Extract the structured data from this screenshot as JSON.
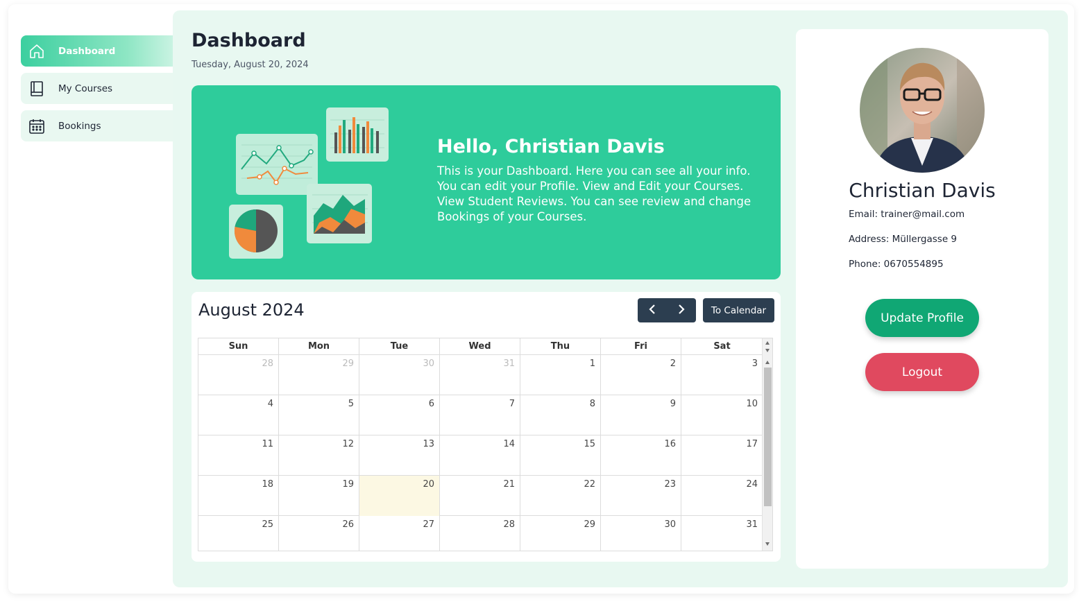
{
  "sidebar": {
    "items": [
      {
        "label": "Dashboard",
        "icon": "home-icon",
        "active": true
      },
      {
        "label": "My Courses",
        "icon": "book-icon",
        "active": false
      },
      {
        "label": "Bookings",
        "icon": "calendar-icon",
        "active": false
      }
    ]
  },
  "header": {
    "title": "Dashboard",
    "date": "Tuesday, August 20, 2024"
  },
  "hero": {
    "title": "Hello, Christian Davis",
    "text": "This is your Dashboard. Here you can see all your info. You can edit your Profile. View and Edit your Courses. View Student Reviews. You can see review and change Bookings of your Courses.",
    "illustration_icon": "analytics-charts-illustration"
  },
  "calendar": {
    "title": "August 2024",
    "prev_icon": "chevron-left-icon",
    "next_icon": "chevron-right-icon",
    "to_calendar_label": "To Calendar",
    "weekdays": [
      "Sun",
      "Mon",
      "Tue",
      "Wed",
      "Thu",
      "Fri",
      "Sat"
    ],
    "weeks": [
      [
        {
          "d": "28",
          "other": true
        },
        {
          "d": "29",
          "other": true
        },
        {
          "d": "30",
          "other": true
        },
        {
          "d": "31",
          "other": true
        },
        {
          "d": "1"
        },
        {
          "d": "2"
        },
        {
          "d": "3"
        }
      ],
      [
        {
          "d": "4"
        },
        {
          "d": "5"
        },
        {
          "d": "6"
        },
        {
          "d": "7"
        },
        {
          "d": "8"
        },
        {
          "d": "9"
        },
        {
          "d": "10"
        }
      ],
      [
        {
          "d": "11"
        },
        {
          "d": "12"
        },
        {
          "d": "13"
        },
        {
          "d": "14"
        },
        {
          "d": "15"
        },
        {
          "d": "16"
        },
        {
          "d": "17"
        }
      ],
      [
        {
          "d": "18"
        },
        {
          "d": "19"
        },
        {
          "d": "20",
          "today": true
        },
        {
          "d": "21"
        },
        {
          "d": "22"
        },
        {
          "d": "23"
        },
        {
          "d": "24"
        }
      ],
      [
        {
          "d": "25"
        },
        {
          "d": "26"
        },
        {
          "d": "27"
        },
        {
          "d": "28"
        },
        {
          "d": "29"
        },
        {
          "d": "30"
        },
        {
          "d": "31"
        }
      ]
    ]
  },
  "profile": {
    "avatar_icon": "profile-photo",
    "name": "Christian Davis",
    "email": "Email: trainer@mail.com",
    "address": "Address: Müllergasse 9",
    "phone": "Phone: 0670554895",
    "update_label": "Update Profile",
    "logout_label": "Logout"
  },
  "colors": {
    "accent": "#2ecc9b",
    "main_bg": "#e8f8f1",
    "nav_dark": "#2c3e50",
    "update": "#10a774",
    "logout": "#e0495f",
    "today": "#fcf8e3"
  }
}
